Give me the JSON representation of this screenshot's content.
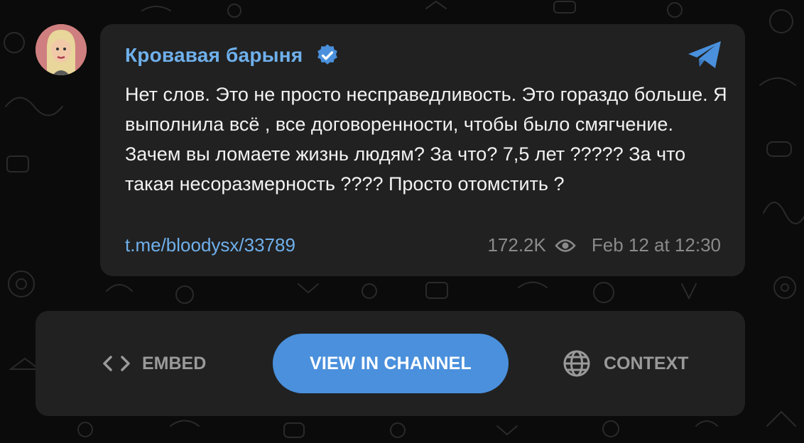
{
  "post": {
    "author": "Кровавая барыня",
    "verified": true,
    "avatar_icon": "avatar-portrait-icon",
    "text": "Нет слов. Это не просто несправедливость. Это гораздо больше. Я выполнила всё , все договоренности, чтобы было смягчение. Зачем вы ломаете жизнь людям? За что? 7,5 лет ????? За что такая несоразмерность ???? Просто отомстить ?",
    "link": "t.me/bloodysx/33789",
    "views": "172.2K",
    "date": "Feb 12 at 12:30"
  },
  "actions": {
    "embed_label": "EMBED",
    "view_label": "VIEW IN CHANNEL",
    "context_label": "CONTEXT"
  },
  "colors": {
    "accent": "#4a90dc",
    "link": "#6fb0ec",
    "card_bg": "#212121",
    "page_bg": "#0b0b0b"
  }
}
